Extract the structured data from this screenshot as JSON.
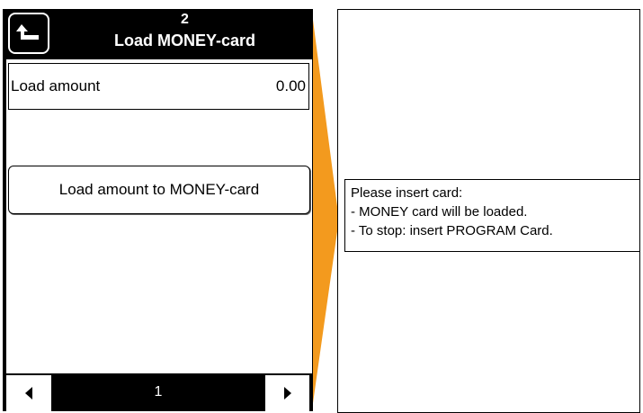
{
  "header": {
    "number": "2",
    "title": "Load MONEY-card"
  },
  "load_amount": {
    "label": "Load amount",
    "value": "0.00"
  },
  "action_button": {
    "label": "Load amount to MONEY-card"
  },
  "footer": {
    "page_number": "1"
  },
  "message": {
    "line1": "Please insert card:",
    "line2": "- MONEY card will be loaded.",
    "line3": "- To stop: insert PROGRAM Card."
  },
  "colors": {
    "arrow_orange": "#F39A1E",
    "device_black": "#000000"
  }
}
